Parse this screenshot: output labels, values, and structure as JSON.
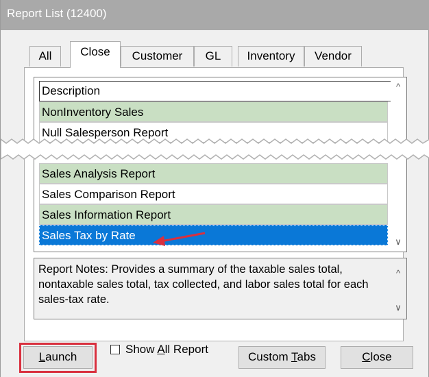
{
  "window": {
    "title": "Report List (12400)"
  },
  "tabs": [
    {
      "label": "All",
      "active": false
    },
    {
      "label": "Close",
      "active": true
    },
    {
      "label": "Customer",
      "active": false
    },
    {
      "label": "GL",
      "active": false
    },
    {
      "label": "Inventory",
      "active": false
    },
    {
      "label": "Vendor",
      "active": false
    }
  ],
  "list": {
    "header": "Description",
    "rows": [
      {
        "label": "NonInventory Sales",
        "style": "green"
      },
      {
        "label": "Null Salesperson Report",
        "style": "white"
      },
      {
        "label": "Sales Analysis Report",
        "style": "green"
      },
      {
        "label": "Sales Comparison Report",
        "style": "white"
      },
      {
        "label": "Sales Information Report",
        "style": "green"
      },
      {
        "label": "Sales Tax by Rate",
        "style": "selected"
      }
    ]
  },
  "notes": {
    "text": "Report Notes:  Provides a summary of the taxable sales total, nontaxable sales total, tax collected, and labor sales total for each sales-tax rate."
  },
  "buttons": {
    "launch_prefix": "",
    "launch_accel": "L",
    "launch_rest": "aunch",
    "show_all_prefix": "Show ",
    "show_all_accel": "A",
    "show_all_rest": "ll Report",
    "custom_tabs_prefix": "Custom ",
    "custom_tabs_accel": "T",
    "custom_tabs_rest": "abs",
    "close_accel": "C",
    "close_rest": "lose"
  },
  "colors": {
    "green_row": "#c9dfc3",
    "selected_row": "#0a78d7",
    "highlight_outline": "#d9303f",
    "arrow": "#d9303f"
  },
  "icons": {
    "scroll_up": "chevron-up-icon",
    "scroll_down": "chevron-down-icon",
    "annotation": "red-arrow-icon"
  }
}
